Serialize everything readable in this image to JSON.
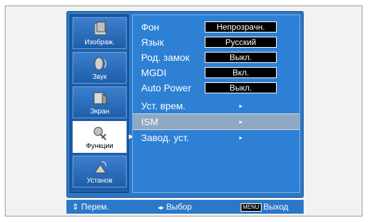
{
  "sidebar": {
    "items": [
      {
        "label": "Изображ.",
        "icon": "picture-icon"
      },
      {
        "label": "Звук",
        "icon": "sound-icon"
      },
      {
        "label": "Экран",
        "icon": "screen-icon"
      },
      {
        "label": "Функции",
        "icon": "function-icon",
        "active": true
      },
      {
        "label": "Установ",
        "icon": "setup-icon"
      }
    ]
  },
  "menu": {
    "rows": [
      {
        "label": "Фон",
        "value": "Непрозрачн."
      },
      {
        "label": "Язык",
        "value": "Русский"
      },
      {
        "label": "Род. замок",
        "value": "Выкл."
      },
      {
        "label": "MGDI",
        "value": "Вкл."
      },
      {
        "label": "Auto Power",
        "value": "Выкл."
      },
      {
        "label": "Уст. врем.",
        "submenu": "▸"
      },
      {
        "label": "ISM",
        "submenu": "▸",
        "selected": true
      },
      {
        "label": "Завод. уст.",
        "submenu": "▸"
      }
    ]
  },
  "footer": {
    "move": "Перем.",
    "move_icon": "⇕",
    "select": "Выбор",
    "select_icon": "◂▸",
    "menu_key": "MENU",
    "exit": "Выход"
  },
  "colors": {
    "osd_blue": "#2b78c9",
    "panel_blue": "#2e80d4",
    "sidebar_blue": "#1f5ea8",
    "selected_row": "#8fa9c4"
  }
}
